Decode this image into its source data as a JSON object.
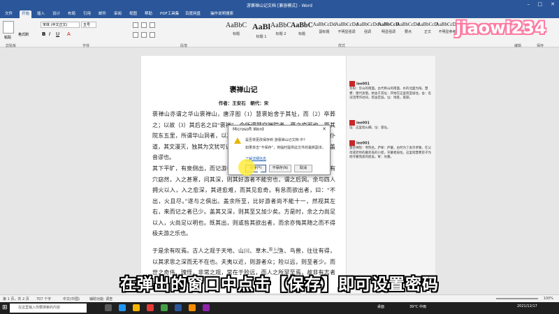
{
  "window": {
    "title": "游褒禅山记文档 [兼容模式] - Word"
  },
  "ribbon_tabs": [
    "文件",
    "开始",
    "插入",
    "设计",
    "布局",
    "引用",
    "邮件",
    "审阅",
    "视图",
    "帮助",
    "PDF工具集",
    "百度网盘",
    "操作说明搜索"
  ],
  "ribbon": {
    "font_name": "宋体 (中文正文)",
    "font_size": "五号",
    "paste_label": "粘贴",
    "format_painter_label": "格式刷",
    "groups": {
      "clipboard": "剪贴板",
      "font": "字体",
      "paragraph": "段落",
      "styles": "样式",
      "editing": "编辑",
      "save": "保存"
    },
    "styles": [
      {
        "sample": "AaBbC",
        "name": "标题"
      },
      {
        "sample": "AaBl",
        "name": "标题 1"
      },
      {
        "sample": "AaBbC",
        "name": "标题 2"
      },
      {
        "sample": "AaBbC",
        "name": "标题"
      },
      {
        "sample": "AaBbCcDd",
        "name": "副标题"
      },
      {
        "sample": "AaBbCcDd",
        "name": "不明显强调"
      },
      {
        "sample": "AaBbCcDd",
        "name": "强调"
      },
      {
        "sample": "AaBbCcD",
        "name": "明显强调"
      },
      {
        "sample": "AaBbCcDd",
        "name": "要点"
      },
      {
        "sample": "AaBbCcD",
        "name": "正文"
      },
      {
        "sample": "AaBbCcDd",
        "name": "不明显参考"
      },
      {
        "sample": "AaBbCcDd",
        "name": "明显参考"
      }
    ]
  },
  "document": {
    "title": "褒禅山记",
    "author": "作者：王安石　朝代：宋",
    "paragraphs": [
      "褒禅山亦谓之华山褒禅山，唐浮图（1）慧褒始舍于其址，而（2）卒葬之；以故（3）其后名之曰“褒禅”。今所谓慧空禅院者，褒之庐冢也。距其院东五里，所谓华山洞者，以其乃华山之阳名之也。距洞百余步，有碑仆道，其文漫灭，独其为文犹可识曰“花山”。今言“华”如“华实”之“华”者，盖音谬也。",
      "其下平旷，有泉侧出，而记游者甚众，所谓前洞也。由山以上五六里，有穴窈然，入之甚寒，问其深，则其好游者不能穷也，谓之后洞。余与四人拥火以入，入之愈深，其进愈难，而其见愈奇。有怠而欲出者，曰：“不出，火且尽。”遂与之俱出。盖余所至，比好游者尚不能十一，然视其左右，来而记之者已少。盖其又深，则其至又加少矣。方是时，余之力尚足以入，火尚足以明也。既其出，则或咎其欲出者，而余亦悔其随之而不得极夫游之乐也。",
      "于是余有叹焉。古人之观于天地、山川、草木、虫鱼、鸟兽，往往有得，以其求思之深而无不在也。夫夷以近，则游者众；险以远，则至者少。而世之奇伟、瑰怪，非常之观，常在于险远，而人之所罕至焉，故非有志者不能至也。"
    ],
    "figure_mark": "图 1-2"
  },
  "comments": [
    {
      "user": "lee001",
      "text": "华阳：华山的南面。古代称山的南面、水的北面为阳。慧褒：唐代高僧。始舍于其址：开始在这里筑室居住。舍：名词活用作动词，筑舍定居。址：地基，基部。"
    },
    {
      "user": "lee001",
      "text": "址：这里指山脚。址：基址。"
    },
    {
      "user": "lee001",
      "text": "慧空禅院：寺院名。庐冢：庐墓，古时为了表示孝敬，在父母或老师的墓旁盖的小屋，守墓者居住。这里指慧褒弟子为他守墓而盖的屋舍。冢：坟墓。"
    }
  ],
  "dialog": {
    "title": "Microsoft Word",
    "message": "是否将更改保存到 游褒禅山记文档 中?",
    "detail": "如果单击“不保存”，将临时提供此文件的最新副本。",
    "link": "了解详细信息",
    "buttons": {
      "save": "保存(S)",
      "dont_save": "不保存(N)",
      "cancel": "取消"
    }
  },
  "statusbar": {
    "page": "第 1 页，共 2 页",
    "words": "707 个字",
    "language": "中文(中国)",
    "accessibility": "辅助功能: 调查",
    "zoom": "100%"
  },
  "taskbar": {
    "search_placeholder": "在这里输入你要搜索的内容",
    "desktop_label": "桌面",
    "weather": "39°C 中雨",
    "time": "2021/12/17"
  },
  "caption": "在弹出的窗口中点击【保存】即可设置密码",
  "watermark": "jiaowi234",
  "colors": {
    "word_blue": "#2b579a",
    "comment_red": "#c62828",
    "highlight_yellow": "#ffeb3b"
  }
}
